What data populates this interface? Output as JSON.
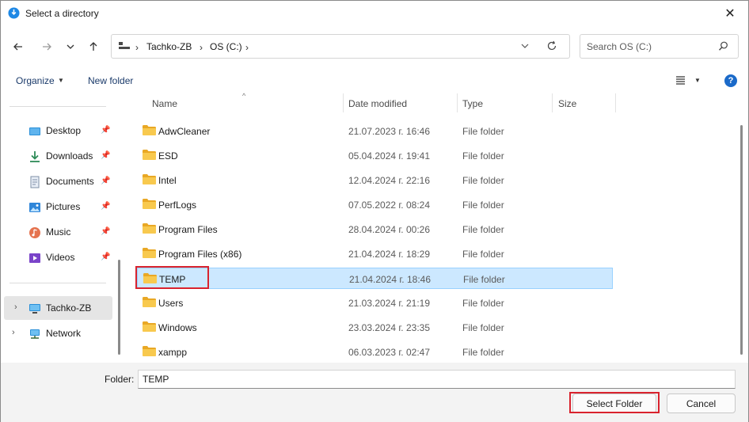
{
  "window": {
    "title": "Select a directory",
    "close_glyph": "✕"
  },
  "nav_buttons": {
    "back": "←",
    "forward": "→",
    "recent": "⌄",
    "up": "↑"
  },
  "address": {
    "crumbs": [
      "Tachko-ZB",
      "OS (C:)"
    ],
    "separator": "›"
  },
  "search": {
    "placeholder": "Search OS (C:)"
  },
  "toolbar": {
    "organize_label": "Organize",
    "new_folder_label": "New folder",
    "help_label": "?"
  },
  "nav_pane": {
    "quick_access": [
      {
        "label": "Desktop",
        "icon": "desktop-icon"
      },
      {
        "label": "Downloads",
        "icon": "downloads-icon"
      },
      {
        "label": "Documents",
        "icon": "documents-icon"
      },
      {
        "label": "Pictures",
        "icon": "pictures-icon"
      },
      {
        "label": "Music",
        "icon": "music-icon"
      },
      {
        "label": "Videos",
        "icon": "videos-icon"
      }
    ],
    "locations": [
      {
        "label": "Tachko-ZB",
        "icon": "computer-icon"
      },
      {
        "label": "Network",
        "icon": "network-icon"
      }
    ]
  },
  "file_list": {
    "columns": [
      "Name",
      "Date modified",
      "Type",
      "Size"
    ],
    "rows": [
      {
        "name": "AdwCleaner",
        "date": "21.07.2023 г. 16:46",
        "type": "File folder"
      },
      {
        "name": "ESD",
        "date": "05.04.2024 г. 19:41",
        "type": "File folder"
      },
      {
        "name": "Intel",
        "date": "12.04.2024 г. 22:16",
        "type": "File folder"
      },
      {
        "name": "PerfLogs",
        "date": "07.05.2022 г. 08:24",
        "type": "File folder"
      },
      {
        "name": "Program Files",
        "date": "28.04.2024 г. 00:26",
        "type": "File folder"
      },
      {
        "name": "Program Files (x86)",
        "date": "21.04.2024 г. 18:29",
        "type": "File folder"
      },
      {
        "name": "TEMP",
        "date": "21.04.2024 г. 18:46",
        "type": "File folder",
        "selected": true
      },
      {
        "name": "Users",
        "date": "21.03.2024 г. 21:19",
        "type": "File folder"
      },
      {
        "name": "Windows",
        "date": "23.03.2024 г. 23:35",
        "type": "File folder"
      },
      {
        "name": "xampp",
        "date": "06.03.2023 г. 02:47",
        "type": "File folder"
      }
    ]
  },
  "footer": {
    "folder_label": "Folder:",
    "folder_value": "TEMP",
    "select_button": "Select Folder",
    "cancel_button": "Cancel"
  },
  "colors": {
    "selection": "#cce8ff",
    "highlight_box": "#d9232e",
    "folder": "#f4c34a"
  }
}
